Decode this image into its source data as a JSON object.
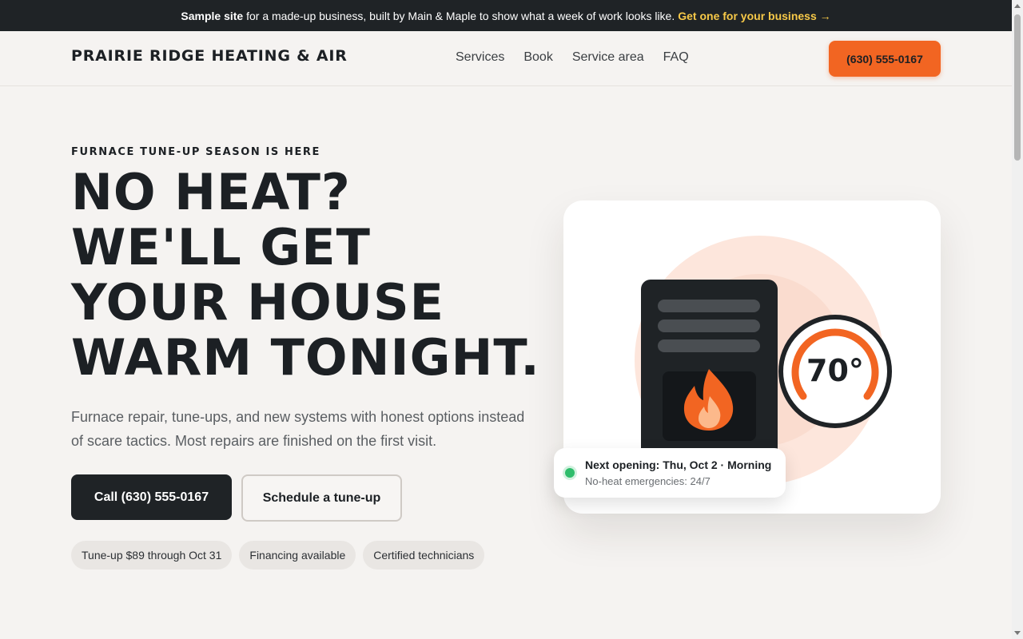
{
  "banner": {
    "bold": "Sample site",
    "text": "for a made-up business, built by Main & Maple to show what a week of work looks like.",
    "cta": "Get one for your business →"
  },
  "header": {
    "brand": "PRAIRIE RIDGE HEATING & AIR",
    "nav": [
      "Services",
      "Book",
      "Service area",
      "FAQ"
    ],
    "phone": "(630) 555-0167"
  },
  "hero": {
    "eyebrow": "FURNACE TUNE-UP SEASON IS HERE",
    "headline_lines": [
      "NO HEAT?",
      "WE'LL GET",
      "YOUR HOUSE",
      "WARM TONIGHT."
    ],
    "subtext": "Furnace repair, tune-ups, and new systems with honest options instead of scare tactics. Most repairs are finished on the first visit.",
    "primary_button": "Call (630) 555-0167",
    "secondary_button": "Schedule a tune-up",
    "pills": [
      "Tune-up $89 through Oct 31",
      "Financing available",
      "Certified technicians"
    ]
  },
  "illustration": {
    "thermostat_reading": "70°",
    "status_title": "Next opening: Thu, Oct 2 · Morning",
    "status_subtitle": "No-heat emergencies: 24/7"
  },
  "colors": {
    "accent": "#f26522",
    "dark": "#1f2326",
    "banner_link": "#f7c948",
    "status_dot": "#2ebd6b"
  }
}
